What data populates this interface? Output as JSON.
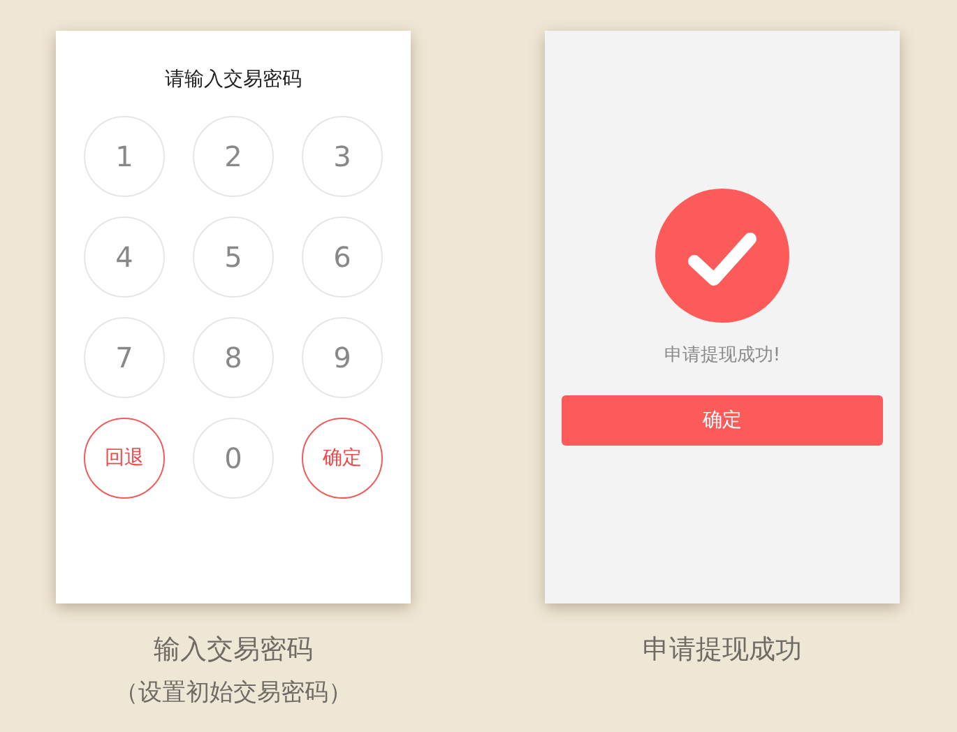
{
  "screens": [
    {
      "kind": "keypad",
      "title": "请输入交易密码",
      "keys": [
        {
          "label": "1",
          "kind": "digit"
        },
        {
          "label": "2",
          "kind": "digit"
        },
        {
          "label": "3",
          "kind": "digit"
        },
        {
          "label": "4",
          "kind": "digit"
        },
        {
          "label": "5",
          "kind": "digit"
        },
        {
          "label": "6",
          "kind": "digit"
        },
        {
          "label": "7",
          "kind": "digit"
        },
        {
          "label": "8",
          "kind": "digit"
        },
        {
          "label": "9",
          "kind": "digit"
        },
        {
          "label": "回退",
          "kind": "action"
        },
        {
          "label": "0",
          "kind": "digit"
        },
        {
          "label": "确定",
          "kind": "action"
        }
      ],
      "caption": "输入交易密码",
      "subcaption": "（设置初始交易密码）"
    },
    {
      "kind": "success",
      "message": "申请提现成功!",
      "button": "确定",
      "caption": "申请提现成功"
    }
  ]
}
